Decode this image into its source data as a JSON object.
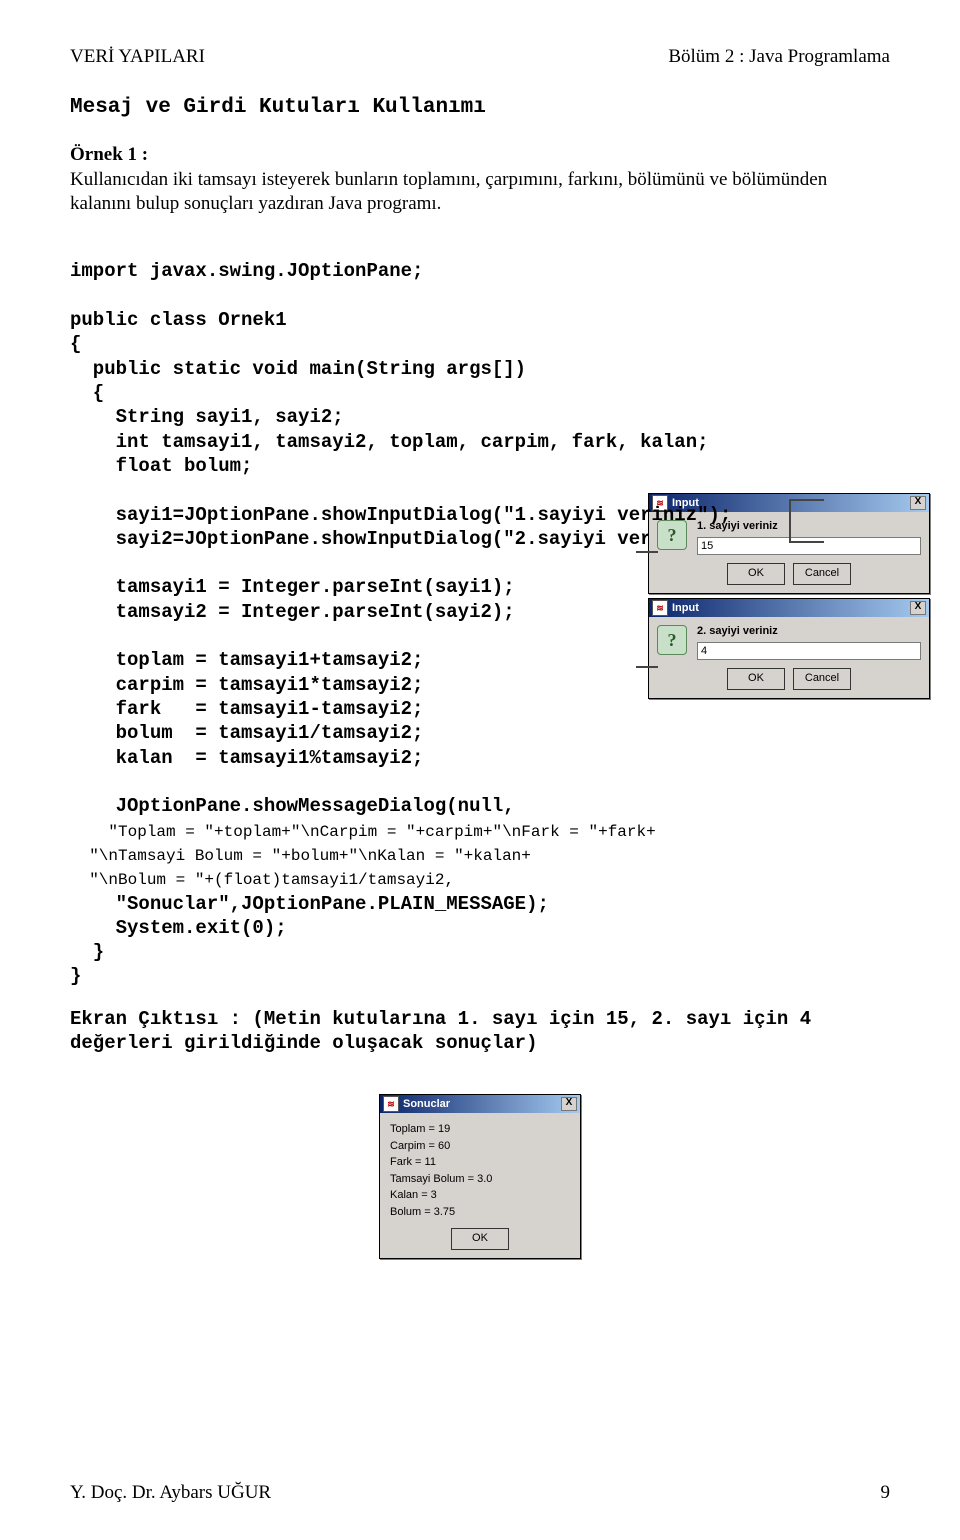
{
  "header": {
    "left": "VERİ YAPILARI",
    "right": "Bölüm 2 : Java Programlama"
  },
  "section_title": "Mesaj ve Girdi Kutuları Kullanımı",
  "intro": {
    "heading": "Örnek 1 :",
    "body": "Kullanıcıdan iki tamsayı isteyerek bunların toplamını, çarpımını, farkını, bölümünü ve bölümünden kalanını bulup sonuçları yazdıran Java programı."
  },
  "code": {
    "l01": "import javax.swing.JOptionPane;",
    "l02": "public class Ornek1",
    "l03": "{",
    "l04": "  public static void main(String args[])",
    "l05": "  {",
    "l06": "    String sayi1, sayi2;",
    "l07": "    int tamsayi1, tamsayi2, toplam, carpim, fark, kalan;",
    "l08": "    float bolum;",
    "l09": "    sayi1=JOptionPane.showInputDialog(\"1.sayiyi veriniz\");",
    "l10": "    sayi2=JOptionPane.showInputDialog(\"2.sayiyi veriniz\");",
    "l11": "    tamsayi1 = Integer.parseInt(sayi1);",
    "l12": "    tamsayi2 = Integer.parseInt(sayi2);",
    "l13": "    toplam = tamsayi1+tamsayi2;",
    "l14": "    carpim = tamsayi1*tamsayi2;",
    "l15": "    fark   = tamsayi1-tamsayi2;",
    "l16": "    bolum  = tamsayi1/tamsayi2;",
    "l17": "    kalan  = tamsayi1%tamsayi2;",
    "l18": "    JOptionPane.showMessageDialog(null,",
    "l19": "    \"Toplam = \"+toplam+\"\\nCarpim = \"+carpim+\"\\nFark = \"+fark+",
    "l20": "  \"\\nTamsayi Bolum = \"+bolum+\"\\nKalan = \"+kalan+",
    "l21": "  \"\\nBolum = \"+(float)tamsayi1/tamsayi2,",
    "l22": "    \"Sonuclar\",JOptionPane.PLAIN_MESSAGE);",
    "l23": "    System.exit(0);",
    "l24": "  }",
    "l25": "}"
  },
  "dialogs": {
    "input1": {
      "title": "Input",
      "label": "1. sayiyi veriniz",
      "value": "15",
      "ok": "OK",
      "cancel": "Cancel",
      "close": "X",
      "icon": "?"
    },
    "input2": {
      "title": "Input",
      "label": "2. sayiyi veriniz",
      "value": "4",
      "ok": "OK",
      "cancel": "Cancel",
      "close": "X",
      "icon": "?"
    }
  },
  "output_label": "Ekran Çıktısı : (Metin kutularına 1. sayı için 15, 2. sayı için 4 değerleri girildiğinde oluşacak sonuçlar)",
  "result": {
    "title": "Sonuclar",
    "close": "X",
    "lines": {
      "toplam": "Toplam = 19",
      "carpim": "Carpim = 60",
      "fark": "Fark = 11",
      "tamsayi_bolum": "Tamsayi Bolum = 3.0",
      "kalan": "Kalan = 3",
      "bolum": "Bolum = 3.75"
    },
    "ok": "OK"
  },
  "footer": {
    "left": "Y. Doç. Dr. Aybars UĞUR",
    "right": "9"
  }
}
